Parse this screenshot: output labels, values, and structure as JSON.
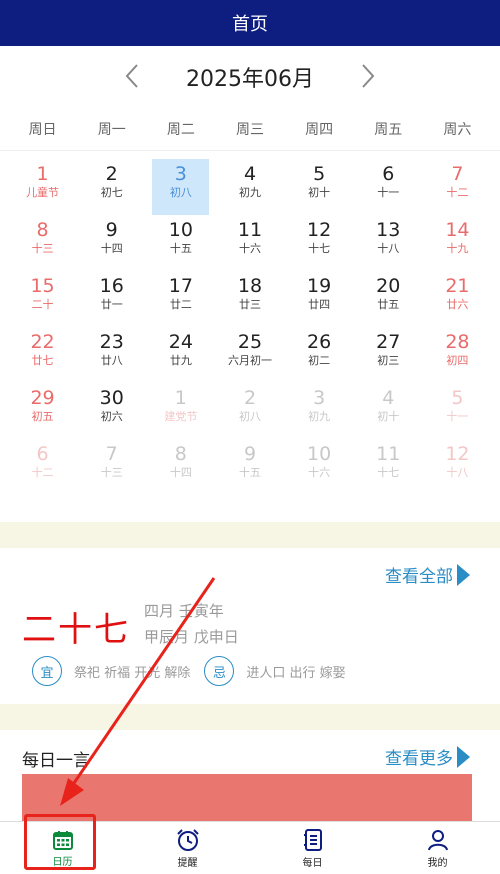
{
  "header": {
    "title": "首页"
  },
  "month_nav": {
    "title": "2025年06月",
    "prev": "‹",
    "next": "›"
  },
  "weekdays": [
    "周日",
    "周一",
    "周二",
    "周三",
    "周四",
    "周五",
    "周六"
  ],
  "days": [
    {
      "day": "1",
      "lunar": "儿童节",
      "type": "weekend holiday"
    },
    {
      "day": "2",
      "lunar": "初七",
      "type": ""
    },
    {
      "day": "3",
      "lunar": "初八",
      "type": "sel"
    },
    {
      "day": "4",
      "lunar": "初九",
      "type": ""
    },
    {
      "day": "5",
      "lunar": "初十",
      "type": ""
    },
    {
      "day": "6",
      "lunar": "十一",
      "type": ""
    },
    {
      "day": "7",
      "lunar": "十二",
      "type": "weekend"
    },
    {
      "day": "8",
      "lunar": "十三",
      "type": "weekend"
    },
    {
      "day": "9",
      "lunar": "十四",
      "type": ""
    },
    {
      "day": "10",
      "lunar": "十五",
      "type": ""
    },
    {
      "day": "11",
      "lunar": "十六",
      "type": ""
    },
    {
      "day": "12",
      "lunar": "十七",
      "type": ""
    },
    {
      "day": "13",
      "lunar": "十八",
      "type": ""
    },
    {
      "day": "14",
      "lunar": "十九",
      "type": "weekend"
    },
    {
      "day": "15",
      "lunar": "二十",
      "type": "weekend"
    },
    {
      "day": "16",
      "lunar": "廿一",
      "type": ""
    },
    {
      "day": "17",
      "lunar": "廿二",
      "type": ""
    },
    {
      "day": "18",
      "lunar": "廿三",
      "type": ""
    },
    {
      "day": "19",
      "lunar": "廿四",
      "type": ""
    },
    {
      "day": "20",
      "lunar": "廿五",
      "type": ""
    },
    {
      "day": "21",
      "lunar": "廿六",
      "type": "weekend"
    },
    {
      "day": "22",
      "lunar": "廿七",
      "type": "weekend"
    },
    {
      "day": "23",
      "lunar": "廿八",
      "type": ""
    },
    {
      "day": "24",
      "lunar": "廿九",
      "type": ""
    },
    {
      "day": "25",
      "lunar": "六月初一",
      "type": ""
    },
    {
      "day": "26",
      "lunar": "初二",
      "type": ""
    },
    {
      "day": "27",
      "lunar": "初三",
      "type": ""
    },
    {
      "day": "28",
      "lunar": "初四",
      "type": "weekend"
    },
    {
      "day": "29",
      "lunar": "初五",
      "type": "weekend"
    },
    {
      "day": "30",
      "lunar": "初六",
      "type": ""
    },
    {
      "day": "1",
      "lunar": "建党节",
      "type": "other holiday"
    },
    {
      "day": "2",
      "lunar": "初八",
      "type": "other"
    },
    {
      "day": "3",
      "lunar": "初九",
      "type": "other"
    },
    {
      "day": "4",
      "lunar": "初十",
      "type": "other"
    },
    {
      "day": "5",
      "lunar": "十一",
      "type": "other weekend"
    },
    {
      "day": "6",
      "lunar": "十二",
      "type": "other weekend"
    },
    {
      "day": "7",
      "lunar": "十三",
      "type": "other"
    },
    {
      "day": "8",
      "lunar": "十四",
      "type": "other"
    },
    {
      "day": "9",
      "lunar": "十五",
      "type": "other"
    },
    {
      "day": "10",
      "lunar": "十六",
      "type": "other"
    },
    {
      "day": "11",
      "lunar": "十七",
      "type": "other"
    },
    {
      "day": "12",
      "lunar": "十八",
      "type": "other weekend"
    }
  ],
  "almanac": {
    "view_all": "查看全部",
    "big_date": "二十七",
    "line1": "四月 壬寅年",
    "line2": "甲辰月 戊申日",
    "yi_label": "宜",
    "yi_text": "祭祀 祈福 开光 解除",
    "ji_label": "忌",
    "ji_text": "进人口 出行 嫁娶"
  },
  "quote": {
    "title": "每日一言",
    "view_more": "查看更多"
  },
  "tabs": [
    {
      "label": "日历",
      "icon": "calendar-icon"
    },
    {
      "label": "提醒",
      "icon": "alarm-clock-icon"
    },
    {
      "label": "每日",
      "icon": "notebook-icon"
    },
    {
      "label": "我的",
      "icon": "user-icon"
    }
  ],
  "colors": {
    "header": "#0e1d80",
    "accent": "#2a8dc5",
    "weekend": "#e96b6b",
    "active_tab": "#0a8a3a",
    "highlight": "#e8231c"
  }
}
